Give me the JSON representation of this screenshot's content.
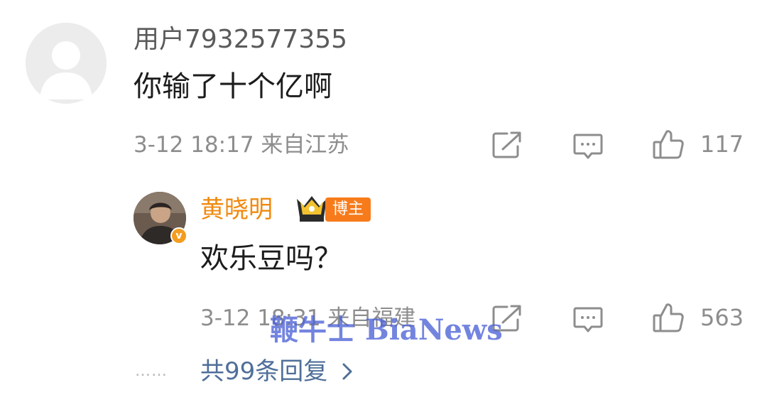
{
  "colors": {
    "username_reply": "#f08a0f",
    "blogger_badge_bg": "#f77b1b",
    "more_link": "#4f6f99",
    "meta_text": "#8d8d8d",
    "watermark": "#4c62d6"
  },
  "comment": {
    "username": "用户7932577355",
    "content": "你输了十个亿啊",
    "meta": "3-12 18:17 来自江苏",
    "actions": {
      "share_icon": "share-icon",
      "comment_icon": "comment-icon",
      "like_icon": "thumbs-up-icon",
      "like_count": "117"
    }
  },
  "reply": {
    "username": "黄晓明",
    "badge_label": "博主",
    "verified_mark": "v",
    "content": "欢乐豆吗？",
    "meta": "3-12 18:31 来自福建",
    "actions": {
      "share_icon": "share-icon",
      "comment_icon": "comment-icon",
      "like_icon": "thumbs-up-icon",
      "like_count": "563"
    }
  },
  "footer": {
    "dots": "……",
    "more_label": "共99条回复"
  },
  "watermark": "鞭牛士 BiaNews"
}
